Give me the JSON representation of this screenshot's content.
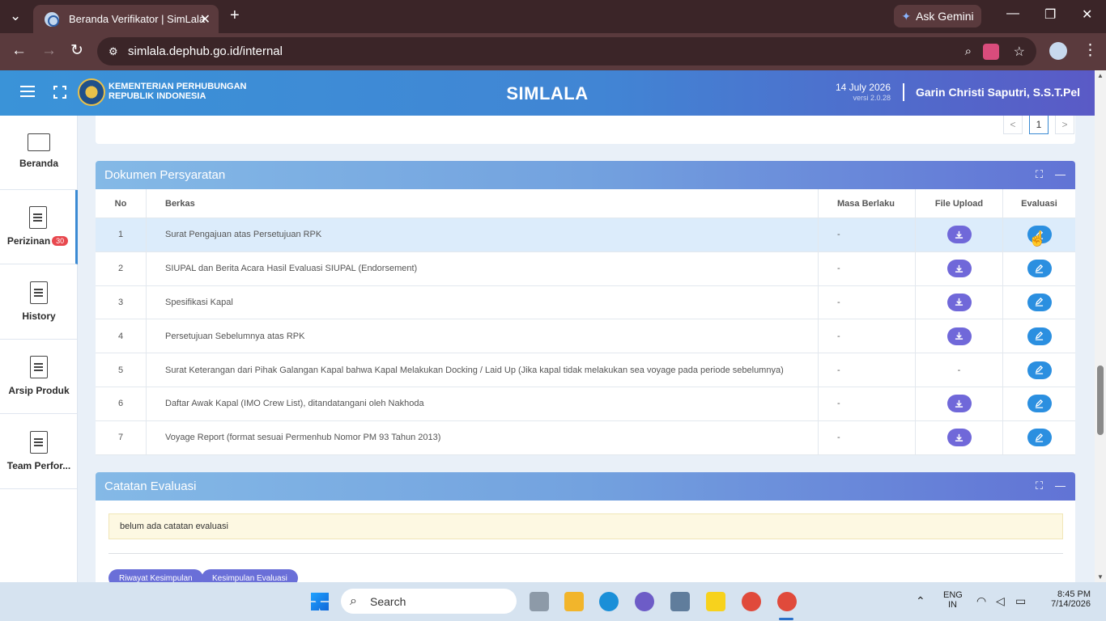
{
  "browser": {
    "tab_title": "Beranda Verifikator | SimLala",
    "url": "simlala.dephub.go.id/internal",
    "gemini_label": "Ask Gemini"
  },
  "header": {
    "ministry_line1": "KEMENTERIAN PERHUBUNGAN",
    "ministry_line2": "REPUBLIK INDONESIA",
    "app_title": "SIMLALA",
    "date": "14 July 2026",
    "version": "versi 2.0.28",
    "user": "Garin Christi Saputri, S.S.T.Pel"
  },
  "sidebar": {
    "items": [
      {
        "label": "Beranda"
      },
      {
        "label": "Perizinan",
        "badge": "30"
      },
      {
        "label": "History"
      },
      {
        "label": "Arsip Produk"
      },
      {
        "label": "Team Perfor..."
      }
    ]
  },
  "pagination": {
    "prev": "<",
    "current": "1",
    "next": ">"
  },
  "dokumen": {
    "title": "Dokumen Persyaratan",
    "columns": [
      "No",
      "Berkas",
      "Masa Berlaku",
      "File Upload",
      "Evaluasi"
    ],
    "rows": [
      {
        "no": "1",
        "berkas": "Surat Pengajuan atas Persetujuan RPK",
        "masa": "-",
        "file": "download"
      },
      {
        "no": "2",
        "berkas": "SIUPAL dan Berita Acara Hasil Evaluasi SIUPAL (Endorsement)",
        "masa": "-",
        "file": "download"
      },
      {
        "no": "3",
        "berkas": "Spesifikasi Kapal",
        "masa": "-",
        "file": "download"
      },
      {
        "no": "4",
        "berkas": "Persetujuan Sebelumnya atas RPK",
        "masa": "-",
        "file": "download"
      },
      {
        "no": "5",
        "berkas": "Surat Keterangan dari Pihak Galangan Kapal bahwa Kapal Melakukan Docking / Laid Up (Jika kapal tidak melakukan sea voyage pada periode sebelumnya)",
        "masa": "-",
        "file": "-"
      },
      {
        "no": "6",
        "berkas": "Daftar Awak Kapal (IMO Crew List), ditandatangani oleh Nakhoda",
        "masa": "-",
        "file": "download"
      },
      {
        "no": "7",
        "berkas": "Voyage Report (format sesuai Permenhub Nomor PM 93 Tahun 2013)",
        "masa": "-",
        "file": "download"
      }
    ]
  },
  "catatan": {
    "title": "Catatan Evaluasi",
    "note": "belum ada catatan evaluasi",
    "btn_riwayat": "Riwayat Kesimpulan",
    "btn_kesimpulan": "Kesimpulan Evaluasi"
  },
  "taskbar": {
    "search_placeholder": "Search",
    "lang1": "ENG",
    "lang2": "IN",
    "time": "8:45 PM",
    "date": "7/14/2026"
  },
  "colors": {
    "accent": "#3a8ad3",
    "download_btn": "#7068d9",
    "edit_btn": "#2b8fe0",
    "badge": "#e8484e"
  }
}
